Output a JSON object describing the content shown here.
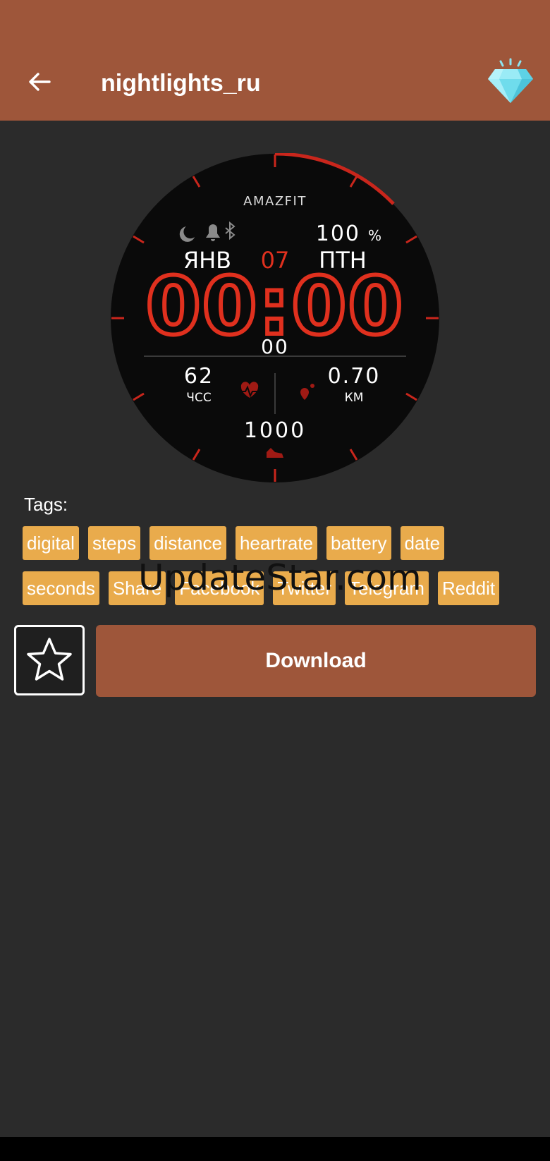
{
  "app": {
    "title": "nightlights_ru"
  },
  "watchface": {
    "brand": "AMAZFIT",
    "battery_value": "100",
    "battery_unit": "%",
    "month": "ЯНВ",
    "day": "07",
    "weekday": "ПТН",
    "time": "00:00",
    "seconds": "00",
    "heart_rate": "62",
    "heart_rate_label": "ЧСС",
    "distance": "0.70",
    "distance_label": "КМ",
    "steps": "1000"
  },
  "tags": {
    "label": "Tags:",
    "rows": [
      [
        "digital",
        "steps",
        "distance",
        "heartrate",
        "battery",
        "date"
      ],
      [
        "seconds",
        "Share",
        "Facebook",
        "Twitter",
        "Telegram",
        "Reddit"
      ]
    ]
  },
  "watermark": "UpdateStar.com",
  "actions": {
    "download_label": "Download"
  },
  "colors": {
    "appbar": "#9e563a",
    "background": "#2b2b2b",
    "tag": "#e9ab4c",
    "accent_red": "#e0301e"
  },
  "icons": {
    "back": "arrow-left-icon",
    "premium": "diamond-icon",
    "favorite": "star-outline-icon"
  }
}
